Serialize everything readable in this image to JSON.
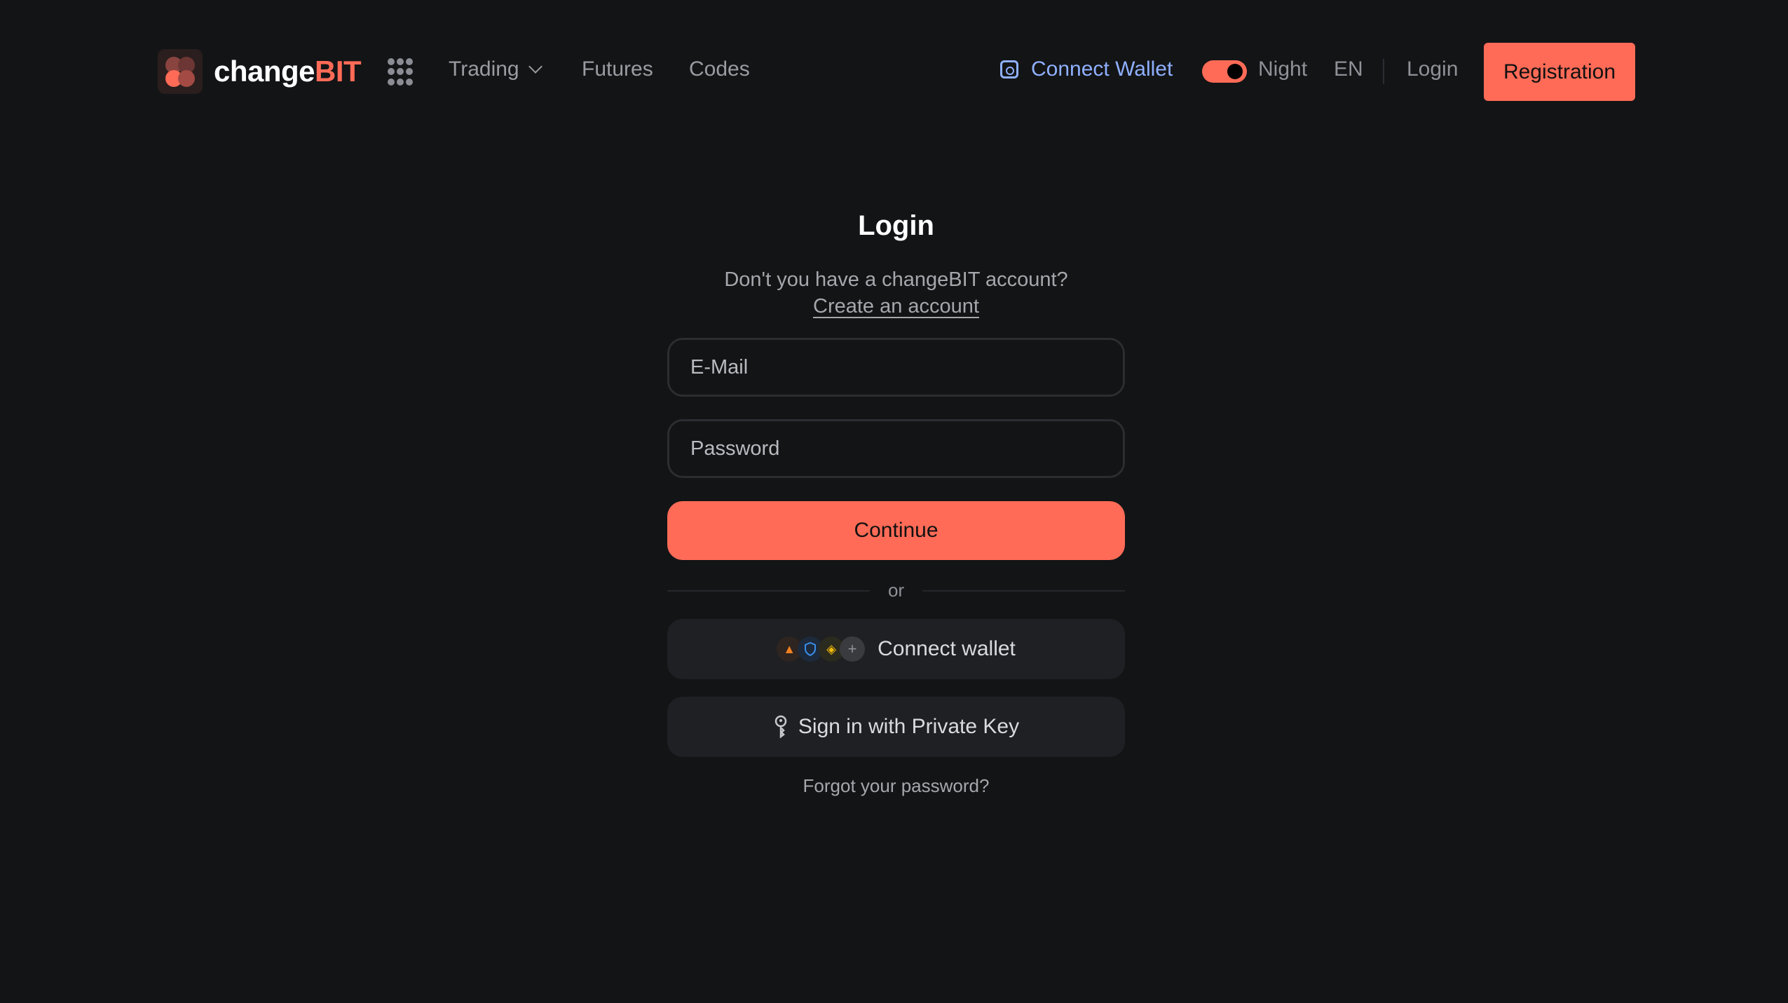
{
  "header": {
    "logo": {
      "prefix": "change",
      "suffix": "BIT"
    },
    "nav": [
      {
        "label": "Trading",
        "has_dropdown": true
      },
      {
        "label": "Futures"
      },
      {
        "label": "Codes"
      }
    ],
    "connect_wallet_label": "Connect Wallet",
    "theme_toggle": {
      "label": "Night",
      "on": true
    },
    "language": "EN",
    "login_label": "Login",
    "registration_label": "Registration"
  },
  "form": {
    "title": "Login",
    "subtitle": "Don't you have a changeBIT account?",
    "create_account_label": "Create an account",
    "email": {
      "value": "",
      "placeholder": "E-Mail"
    },
    "password": {
      "value": "",
      "placeholder": "Password"
    },
    "continue_label": "Continue",
    "divider_label": "or",
    "wallet_icons": [
      "metamask-icon",
      "trust-wallet-icon",
      "binance-icon",
      "plus-icon"
    ],
    "connect_wallet_label": "Connect wallet",
    "private_key_label": "Sign in with Private Key",
    "forgot_label": "Forgot your password?"
  },
  "colors": {
    "background": "#131416",
    "accent": "#ff6b57",
    "link_blue": "#8fb0ff",
    "muted_text": "#8f9197",
    "secondary_button": "#1f2023"
  }
}
